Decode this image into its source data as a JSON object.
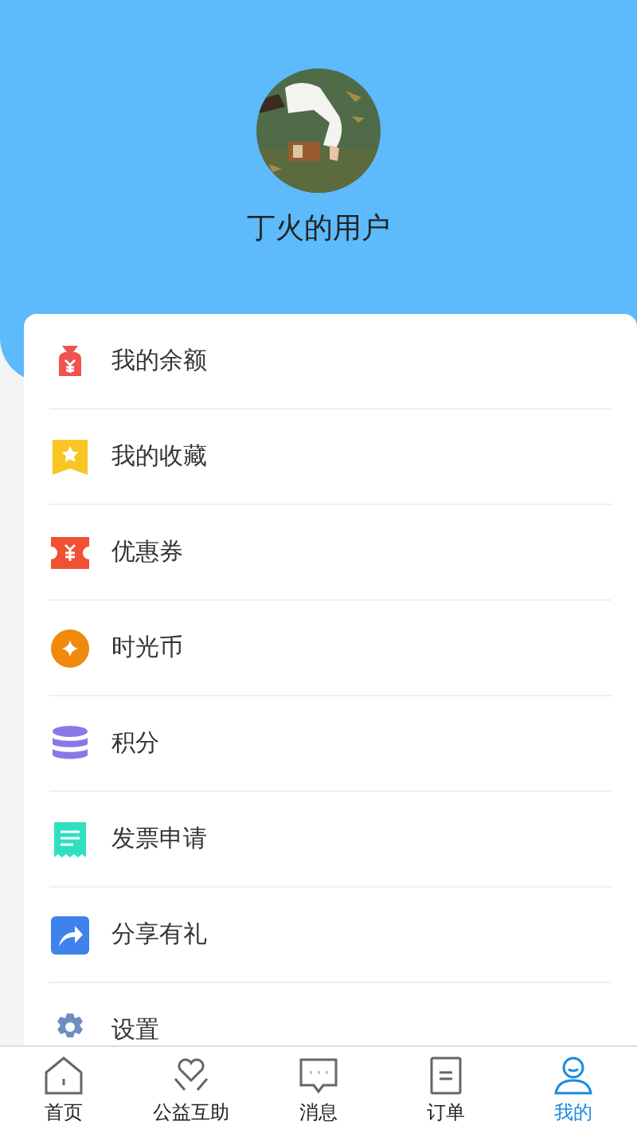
{
  "profile": {
    "username": "丁火的用户"
  },
  "menu": [
    {
      "kind": "moneybag",
      "label": "我的余额"
    },
    {
      "kind": "bookmark",
      "label": "我的收藏"
    },
    {
      "kind": "coupon",
      "label": "优惠券"
    },
    {
      "kind": "coin",
      "label": "时光币"
    },
    {
      "kind": "stack",
      "label": "积分"
    },
    {
      "kind": "invoice",
      "label": "发票申请"
    },
    {
      "kind": "share",
      "label": "分享有礼"
    },
    {
      "kind": "gear",
      "label": "设置"
    }
  ],
  "tabbar": [
    {
      "kind": "home",
      "label": "首页",
      "selected": false
    },
    {
      "kind": "heart",
      "label": "公益互助",
      "selected": false
    },
    {
      "kind": "message",
      "label": "消息",
      "selected": false
    },
    {
      "kind": "order",
      "label": "订单",
      "selected": false
    },
    {
      "kind": "user",
      "label": "我的",
      "selected": true
    }
  ]
}
